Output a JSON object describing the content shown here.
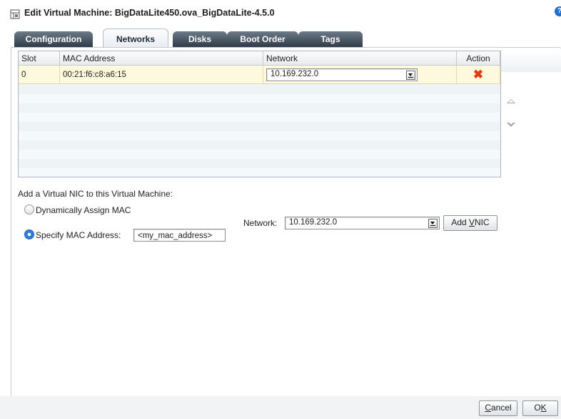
{
  "dialog": {
    "title": "Edit Virtual Machine: BigDataLite450.ova_BigDataLite-4.5.0",
    "help_glyph": "?"
  },
  "tabs": [
    {
      "label": "Configuration",
      "active": false
    },
    {
      "label": "Networks",
      "active": true
    },
    {
      "label": "Disks",
      "active": false
    },
    {
      "label": "Boot Order",
      "active": false
    },
    {
      "label": "Tags",
      "active": false
    }
  ],
  "nic_table": {
    "columns": [
      "Slot",
      "MAC Address",
      "Network",
      "Action"
    ],
    "rows": [
      {
        "slot": "0",
        "mac": "00:21:f6:c8:a6:15",
        "network": "10.169.232.0",
        "action_icon": "delete-icon"
      }
    ]
  },
  "add_vnic": {
    "section_label": "Add a Virtual NIC to this Virtual Machine:",
    "option_dynamic": "Dynamically Assign MAC",
    "option_specify": "Specify MAC Address:",
    "selected_option": "specify",
    "mac_value": "<my_mac_address>",
    "network_label": "Network:",
    "network_value": "10.169.232.0",
    "add_button": {
      "prefix": "Add ",
      "mnemonic": "V",
      "suffix": "NIC"
    }
  },
  "footer": {
    "cancel": {
      "mnemonic": "C",
      "suffix": "ancel"
    },
    "ok": {
      "prefix": "O",
      "mnemonic": "K"
    }
  },
  "colors": {
    "tab_inactive": "#3b4754",
    "row_highlight": "#fdf9dc",
    "delete_icon": "#e03a10",
    "radio_selected": "#2d7fd8"
  }
}
